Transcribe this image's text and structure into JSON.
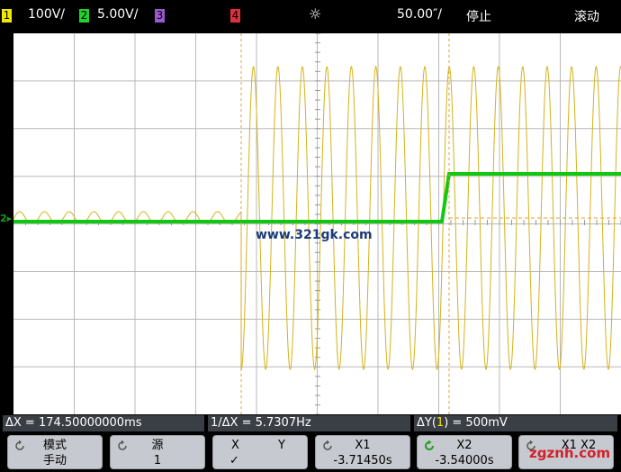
{
  "status_bar": {
    "ch1_num": "1",
    "ch1_scale": "100V/",
    "ch2_num": "2",
    "ch2_scale": "5.00V/",
    "ch3_num": "3",
    "ch4_num": "4",
    "sun_icon": "☼",
    "timebase": "50.00″/",
    "run_state": "停止",
    "mode": "滚动",
    "colors": {
      "ch1": "#f3e600",
      "ch2": "#22d22b",
      "ch3": "#9b59d0",
      "ch4": "#e0303a"
    }
  },
  "screen": {
    "watermark": "www.321gk.com",
    "ground_marker": "2▸",
    "trace_colors": {
      "ch1": "#d4b21a",
      "ch2": "#10c810",
      "cursor": "#e0a030"
    }
  },
  "measurements": {
    "delta_x": "ΔX = 174.50000000ms",
    "inv_delta_x": "1/ΔX = 5.7307Hz",
    "delta_y_prefix": "ΔY(",
    "delta_y_ch": "1",
    "delta_y_suffix": ") = 500mV"
  },
  "softkeys": [
    {
      "line1": "模式",
      "line2": "手动",
      "icon": "rotate-icon"
    },
    {
      "line1": "源",
      "line2": "1",
      "icon": "rotate-icon"
    },
    {
      "line1": "X",
      "line1b": "Y",
      "line2": "✓"
    },
    {
      "line1": "X1",
      "line2": "-3.71450s",
      "icon": "rotate-icon"
    },
    {
      "line1": "X2",
      "line2": "-3.54000s",
      "icon": "rotate-green-icon"
    },
    {
      "line1": "X1 X2",
      "icon": "rotate-icon"
    }
  ],
  "footer_watermark": "zgznh.com"
}
